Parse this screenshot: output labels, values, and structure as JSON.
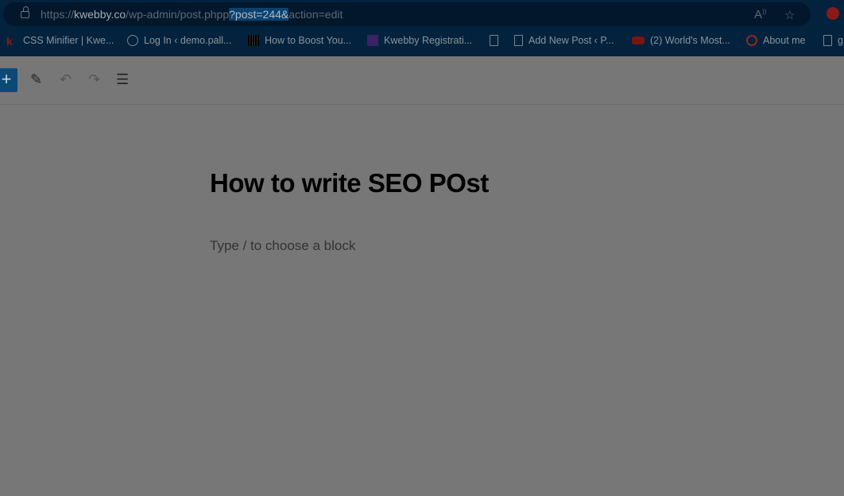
{
  "browser": {
    "url": {
      "scheme": "https://",
      "host": "kwebby.co",
      "path": "/wp-admin/post.php",
      "pre_sel": "p",
      "selected": "?post=244&",
      "after": "action=edit"
    },
    "icons": [
      "lock-icon",
      "read-aloud-icon",
      "star-icon",
      "extension-icon"
    ],
    "bookmarks": [
      {
        "label": "CSS Minifier | Kwe...",
        "icon": "kwebby-icon"
      },
      {
        "label": "Log In ‹ demo.pall...",
        "icon": "wordpress-icon"
      },
      {
        "label": "How to Boost You...",
        "icon": "barcode-icon"
      },
      {
        "label": "Kwebby Registrati...",
        "icon": "list-icon"
      },
      {
        "label": "",
        "icon": "file-icon"
      },
      {
        "label": "Add New Post ‹ P...",
        "icon": "file-icon"
      },
      {
        "label": "(2) World's Most...",
        "icon": "youtube-icon"
      },
      {
        "label": "About me",
        "icon": "google-icon"
      },
      {
        "label": "g",
        "icon": "file-icon"
      }
    ]
  },
  "editor": {
    "toolbar": {
      "add": "+",
      "edit": "✎",
      "undo": "↶",
      "redo": "↷",
      "outline": "☰"
    },
    "post_title": "How to write SEO POst",
    "block_placeholder": "Type / to choose a block"
  }
}
